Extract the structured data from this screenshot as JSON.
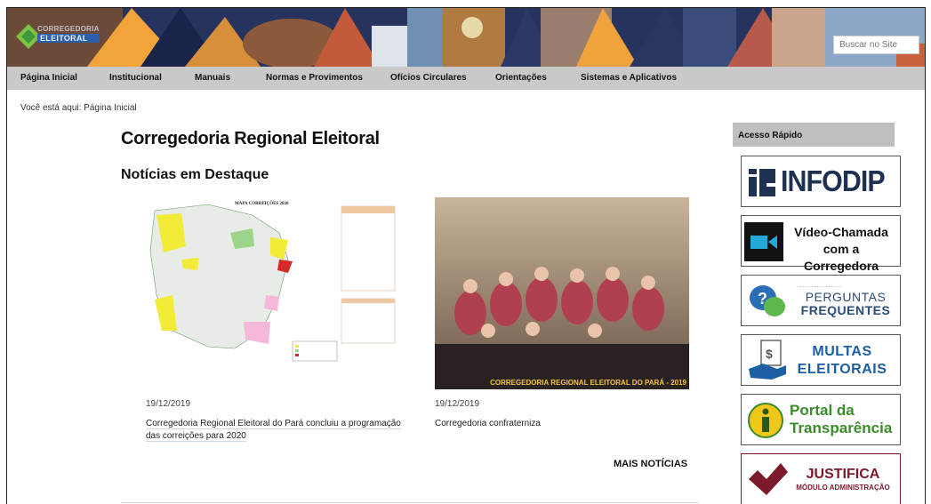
{
  "header": {
    "logo_line1": "CORREGEDORIA",
    "logo_line2": "ELEITORAL",
    "search_placeholder": "Buscar no Site"
  },
  "nav": {
    "items": [
      "Página Inicial",
      "Institucional",
      "Manuais",
      "Normas e Provimentos",
      "Ofícios Circulares",
      "Orientações",
      "Sistemas e Aplicativos"
    ]
  },
  "breadcrumb": {
    "prefix": "Você está aqui: ",
    "current": "Página Inicial"
  },
  "page": {
    "title": "Corregedoria Regional Eleitoral",
    "section_title": "Notícias em Destaque"
  },
  "news": [
    {
      "date": "19/12/2019",
      "title": "Corregedoria Regional Eleitoral do Pará concluiu a programação das correições para 2020",
      "image_caption": "MAPA CORREIÇÕES 2020"
    },
    {
      "date": "19/12/2019",
      "title": "Corregedoria confraterniza",
      "image_caption": "CORREGEDORIA REGIONAL ELEITORAL DO PARÁ - 2019"
    }
  ],
  "more_news": "MAIS NOTÍCIAS",
  "sidebar": {
    "title": "Acesso Rápido",
    "links": [
      {
        "line1": "INFODIP",
        "line2": "",
        "icon": "infodip-icon"
      },
      {
        "line1": "Vídeo-Chamada",
        "line2": "com a Corregedora",
        "icon": "video-camera-icon"
      },
      {
        "line1": "PERGUNTAS",
        "line2": "FREQUENTES",
        "icon": "question-bubbles-icon"
      },
      {
        "line1": "MULTAS",
        "line2": "ELEITORAIS",
        "icon": "money-hand-icon"
      },
      {
        "line1": "Portal da",
        "line2": "Transparência",
        "icon": "info-icon"
      },
      {
        "line1": "JUSTIFICA",
        "line2": "MÓDULO ADMINISTRAÇÃO",
        "icon": "checkmark-icon"
      }
    ]
  },
  "colors": {
    "nav_bg": "#c9c9c9",
    "infodip": "#1f3150",
    "video": "#111111",
    "perguntas": "#2a6fb5",
    "multas": "#1d5fa3",
    "portal": "#3b8c2b",
    "justifica": "#7a1a2a"
  }
}
